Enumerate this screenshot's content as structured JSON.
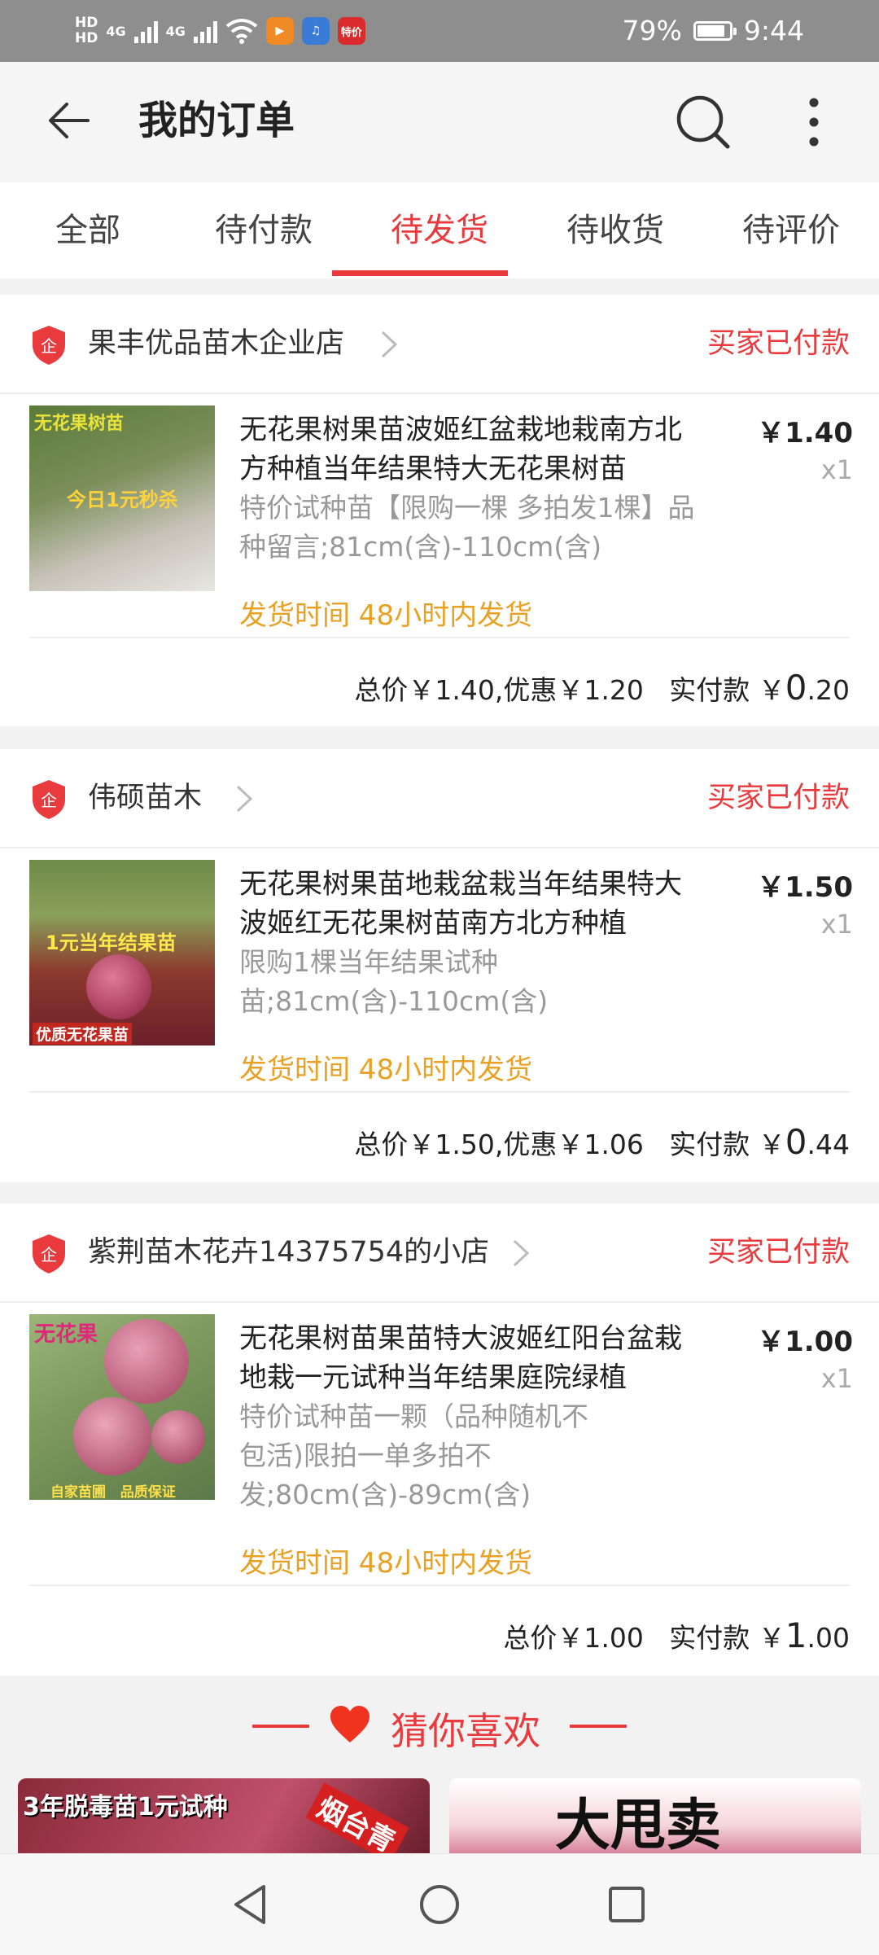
{
  "status_bar": {
    "hd1": "HD",
    "hd2": "HD",
    "sim1": "4G",
    "sim2": "4G",
    "promo_icon_text": "特价",
    "battery": "79%",
    "battery_level": 0.79,
    "time": "9:44"
  },
  "header": {
    "title": "我的订单",
    "back_icon": "arrow-left-icon",
    "search_icon": "search-icon",
    "more_icon": "more-vertical-icon"
  },
  "tabs": [
    {
      "label": "全部"
    },
    {
      "label": "待付款"
    },
    {
      "label": "待发货",
      "active": true
    },
    {
      "label": "待收货"
    },
    {
      "label": "待评价"
    }
  ],
  "orders": [
    {
      "shop": "果丰优品苗木企业店",
      "status": "买家已付款",
      "title": "无花果树果苗波姬红盆栽地栽南方北方种植当年结果特大无花果树苗",
      "spec": "特价试种苗【限购一棵 多拍发1棵】品种留言;81cm(含)-110cm(含)",
      "price": "￥1.40",
      "qty": "x1",
      "ship": "发货时间 48小时内发货",
      "summary_prefix": "总价￥1.40,优惠￥1.20   实付款 ￥",
      "paid_int": "0",
      "paid_dec": ".20",
      "img_banner": "无花果树苗",
      "img_text": "今日1元秒杀"
    },
    {
      "shop": "伟硕苗木",
      "status": "买家已付款",
      "title": "无花果树果苗地栽盆栽当年结果特大波姬红无花果树苗南方北方种植",
      "spec": "限购1棵当年结果试种苗;81cm(含)-110cm(含)",
      "price": "￥1.50",
      "qty": "x1",
      "ship": "发货时间 48小时内发货",
      "summary_prefix": "总价￥1.50,优惠￥1.06   实付款 ￥",
      "paid_int": "0",
      "paid_dec": ".44",
      "img_banner": "1元当年结果苗",
      "img_text": "优质无花果苗"
    },
    {
      "shop": "紫荆苗木花卉14375754的小店",
      "status": "买家已付款",
      "title": "无花果树苗果苗特大波姬红阳台盆栽地栽一元试种当年结果庭院绿植",
      "spec": "特价试种苗一颗（品种随机不包活)限拍一单多拍不发;80cm(含)-89cm(含)",
      "price": "￥1.00",
      "qty": "x1",
      "ship": "发货时间 48小时内发货",
      "summary_prefix": "总价￥1.00   实付款 ￥",
      "paid_int": "1",
      "paid_dec": ".00",
      "img_banner": "无花果",
      "img_text": "自家苗圃   品质保证"
    }
  ],
  "recommend": {
    "title": "猜你喜欢",
    "heart_icon": "heart-icon",
    "cards": [
      {
        "text": "3年脱毒苗1元试种",
        "tag": "烟台青"
      },
      {
        "text": "大甩卖"
      }
    ]
  },
  "navbar": {
    "back": "triangle-back-icon",
    "home": "circle-home-icon",
    "recents": "square-recents-icon"
  },
  "colors": {
    "accent": "#e93b3d",
    "ship": "#e8a125",
    "statusbar": "#8e8e8e"
  }
}
